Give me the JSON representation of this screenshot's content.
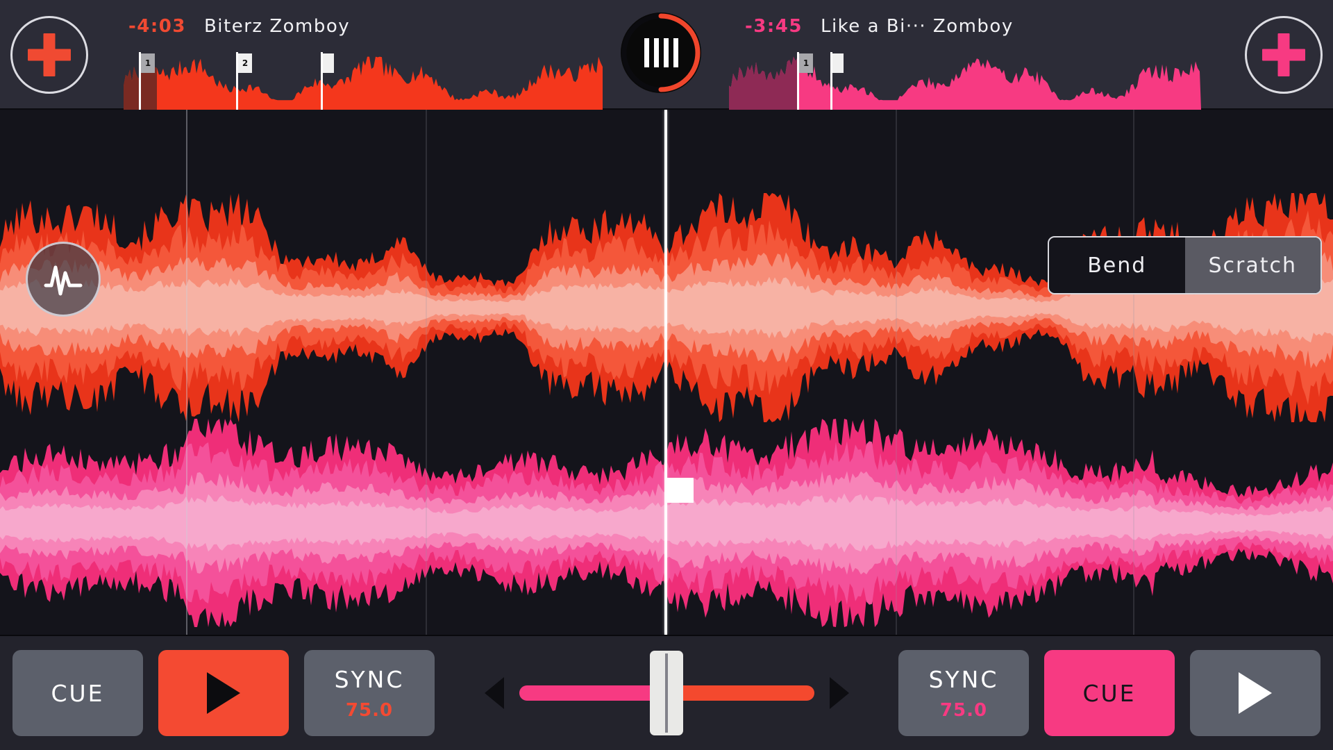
{
  "app": {
    "name": "dj-mixer"
  },
  "header": {
    "add_left": {
      "icon": "plus-icon",
      "color": "#f04a32"
    },
    "add_right": {
      "icon": "plus-icon",
      "color": "#f73a82"
    },
    "center_transport": {
      "icon": "beat-bars-icon",
      "bars": 4,
      "ring_color": "#f0462c"
    }
  },
  "decks": {
    "left": {
      "id": "deck-a",
      "time_remaining": "-4:03",
      "track_title": "Biterz",
      "artist": "Zomboy",
      "title_line": "Biterz  Zomboy",
      "accent": "#f04a32",
      "bpm": "75.0",
      "cue_markers": [
        {
          "label": "1",
          "position_pct": 3.2,
          "dim": true
        },
        {
          "label": "2",
          "position_pct": 23.5,
          "dim": false
        }
      ],
      "playhead_pct": 38.5,
      "transport": {
        "cue_label": "CUE",
        "cue_active": false,
        "play_label": "play-icon",
        "play_active": true,
        "sync_label": "SYNC",
        "sync_bpm": "75.0"
      }
    },
    "right": {
      "id": "deck-b",
      "time_remaining": "-3:45",
      "track_title": "Like a Bi···",
      "artist": "Zomboy",
      "title_line": "Like a Bi···  Zomboy",
      "accent": "#f73a82",
      "bpm": "75.0",
      "cue_markers": [
        {
          "label": "1",
          "position_pct": 14.5,
          "dim": true
        },
        {
          "label": "",
          "position_pct": 21.5,
          "dim": false
        }
      ],
      "playhead_pct": 21.5,
      "transport": {
        "sync_label": "SYNC",
        "sync_bpm": "75.0",
        "cue_label": "CUE",
        "cue_active": true,
        "play_label": "play-icon",
        "play_active": false
      }
    }
  },
  "main_view": {
    "zoom_button": {
      "icon": "waveform-icon"
    },
    "grid_button": {
      "icon": "beatgrid-icon"
    },
    "mode_toggle": {
      "options": [
        "Bend",
        "Scratch"
      ],
      "selected": "Scratch"
    },
    "playhead_pct": 50.0
  },
  "crossfader": {
    "left_arrow": "arrow-left-icon",
    "right_arrow": "arrow-right-icon",
    "value_pct": 50,
    "left_color": "#f73a82",
    "right_color": "#f4492e"
  },
  "colors": {
    "background": "#14141b",
    "header_bg": "#2c2c37",
    "bottom_bg": "#23232c",
    "deck_a": "#f04a32",
    "deck_b": "#f73a82",
    "button_grey": "#5c606b"
  }
}
